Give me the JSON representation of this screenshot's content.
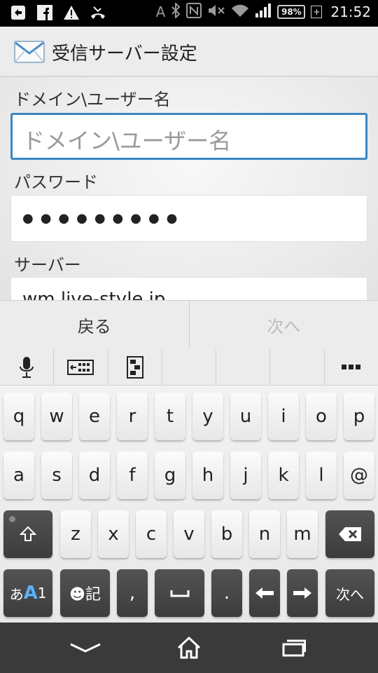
{
  "status_bar": {
    "left_icons": [
      "download-arrow-icon",
      "facebook-icon",
      "warning-icon",
      "missed-call-icon"
    ],
    "right_icons": [
      "font-a-icon",
      "bluetooth-icon",
      "nfc-icon",
      "mute-icon",
      "wifi-icon",
      "signal-icon"
    ],
    "battery": "98%",
    "time": "21:52"
  },
  "action_bar": {
    "title": "受信サーバー設定"
  },
  "form": {
    "domain_label": "ドメイン\\ユーザー名",
    "domain_placeholder": "ドメイン\\ユーザー名",
    "password_label": "パスワード",
    "password_value": "●●●●●●●●●",
    "server_label": "サーバー",
    "server_value": "wm.live-style.jp"
  },
  "nav": {
    "back": "戻る",
    "next": "次へ"
  },
  "keyboard": {
    "row1": [
      "q",
      "w",
      "e",
      "r",
      "t",
      "y",
      "u",
      "i",
      "o",
      "p"
    ],
    "row2": [
      "a",
      "s",
      "d",
      "f",
      "g",
      "h",
      "j",
      "k",
      "l",
      "@"
    ],
    "row3": [
      "z",
      "x",
      "c",
      "v",
      "b",
      "n",
      "m"
    ],
    "emoji_key": "☻記",
    "comma": ",",
    "period": ".",
    "enter": "次へ",
    "mode_key_a": "あ",
    "mode_key_b": "A",
    "mode_key_c": "1"
  }
}
